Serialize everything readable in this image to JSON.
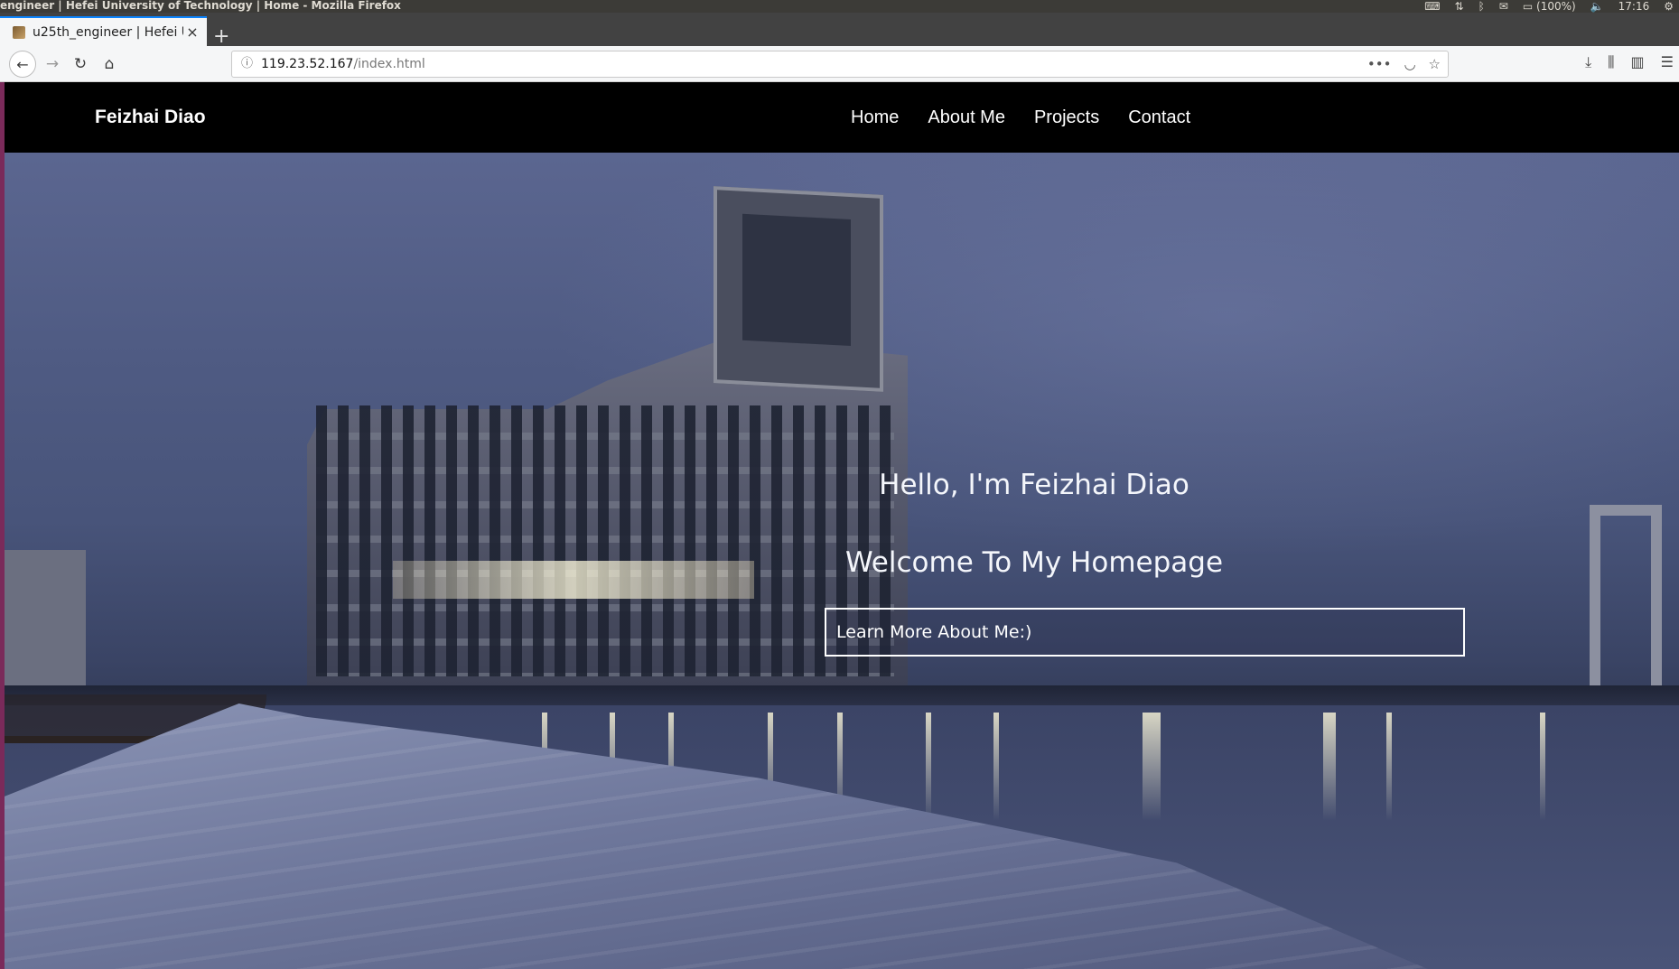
{
  "os": {
    "window_title": "engineer | Hefei University of Technology | Home - Mozilla Firefox",
    "battery": "(100%)",
    "clock": "17:16"
  },
  "browser": {
    "tab_title": "u25th_engineer | Hefei U",
    "new_tab_symbol": "+",
    "close_symbol": "×",
    "url_host": "119.23.52.167",
    "url_path": "/index.html"
  },
  "site": {
    "brand": "Feizhai Diao",
    "menu": [
      "Home",
      "About Me",
      "Projects",
      "Contact"
    ],
    "hero": {
      "hello": "Hello, I'm Feizhai Diao",
      "welcome": "Welcome To My Homepage",
      "cta": "Learn More About Me:)"
    }
  },
  "colors": {
    "nav_bg": "#000000",
    "tab_accent": "#0a84ff",
    "hero_text": "#f4f6fb"
  }
}
